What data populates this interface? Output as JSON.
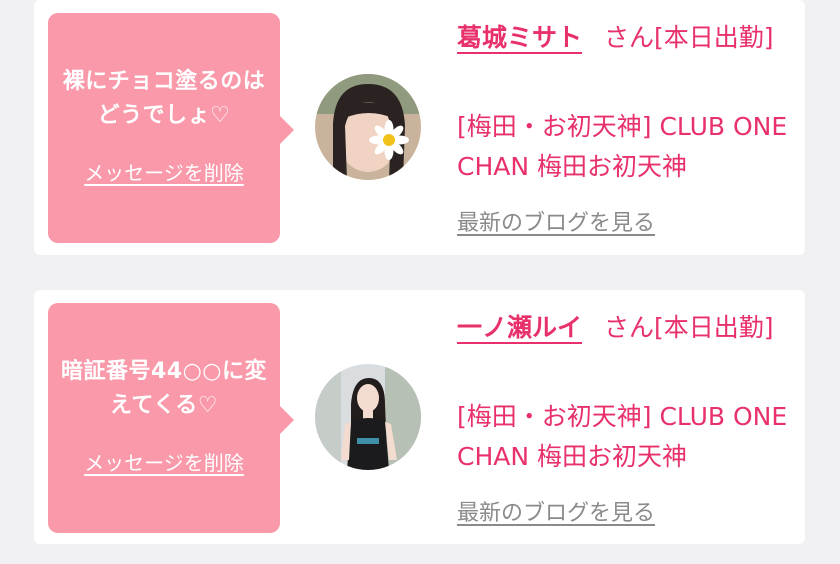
{
  "messages": [
    {
      "bubble_text": "裸にチョコ塗るのはどうでしょ♡",
      "delete_label": "メッセージを削除",
      "name": "葛城ミサト",
      "suffix": "さん[本日出勤]",
      "shop": "[梅田・お初天神] CLUB ONE CHAN 梅田お初天神",
      "blog_label": "最新のブログを見る"
    },
    {
      "bubble_text": "暗証番号44○○に変えてくる♡",
      "delete_label": "メッセージを削除",
      "name": "一ノ瀬ルイ",
      "suffix": "さん[本日出勤]",
      "shop": "[梅田・お初天神] CLUB ONE CHAN 梅田お初天神",
      "blog_label": "最新のブログを見る"
    }
  ],
  "colors": {
    "bubble": "#f999aa",
    "accent": "#e8306a",
    "muted": "#8a8a8a",
    "background": "#f1f1f3"
  }
}
